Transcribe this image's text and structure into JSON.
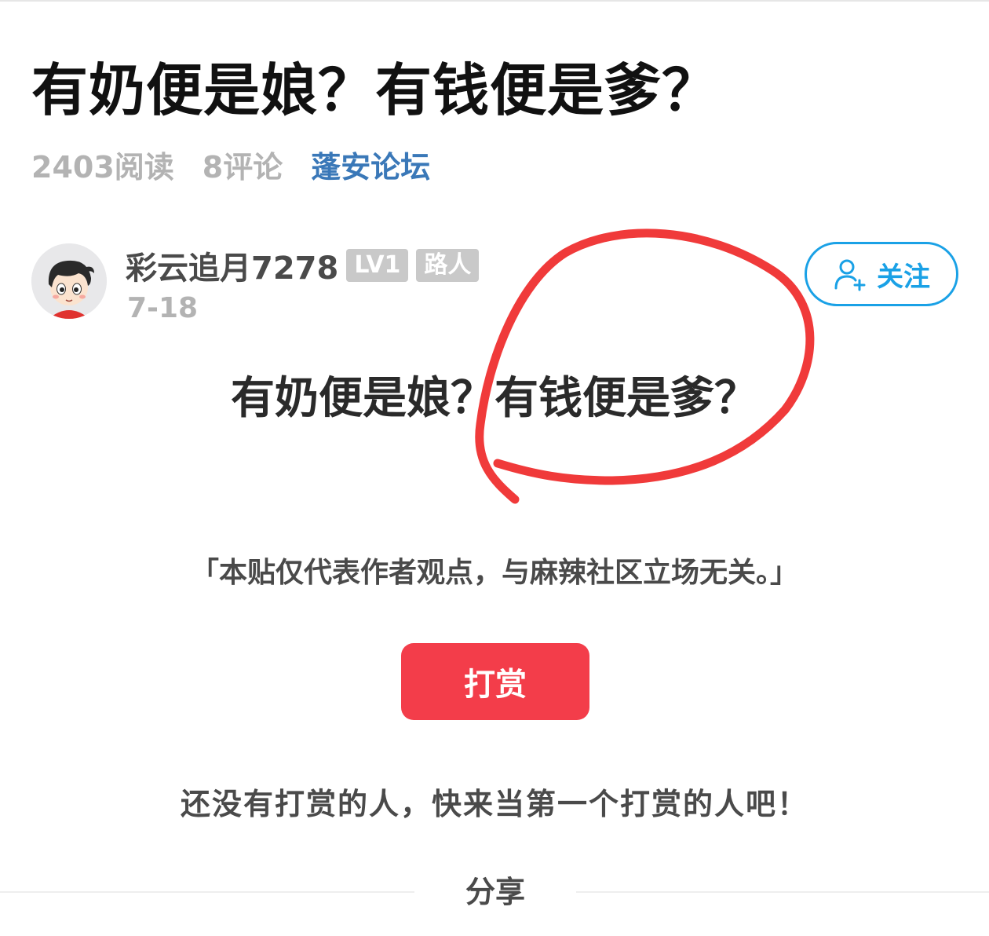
{
  "article": {
    "title": "有奶便是娘？有钱便是爹？",
    "reads": "2403阅读",
    "comments": "8评论",
    "forum": "蓬安论坛"
  },
  "author": {
    "name": "彩云追月7278",
    "level_badge": "LV1",
    "role_badge": "路人",
    "date": "7-18",
    "follow_label": "关注"
  },
  "content": {
    "heading": "有奶便是娘？有钱便是爹？",
    "disclaimer": "「本贴仅代表作者观点，与麻辣社区立场无关。」"
  },
  "reward": {
    "button_label": "打赏",
    "empty_text": "还没有打赏的人，快来当第一个打赏的人吧！"
  },
  "share": {
    "label": "分享"
  },
  "colors": {
    "accent_blue": "#1aa1e6",
    "forum_blue": "#3a78b8",
    "reward_red": "#f33d4a",
    "annotation_red": "#f03a3a"
  },
  "icons": {
    "follow": "add-user-icon",
    "avatar": "cartoon-avatar"
  }
}
